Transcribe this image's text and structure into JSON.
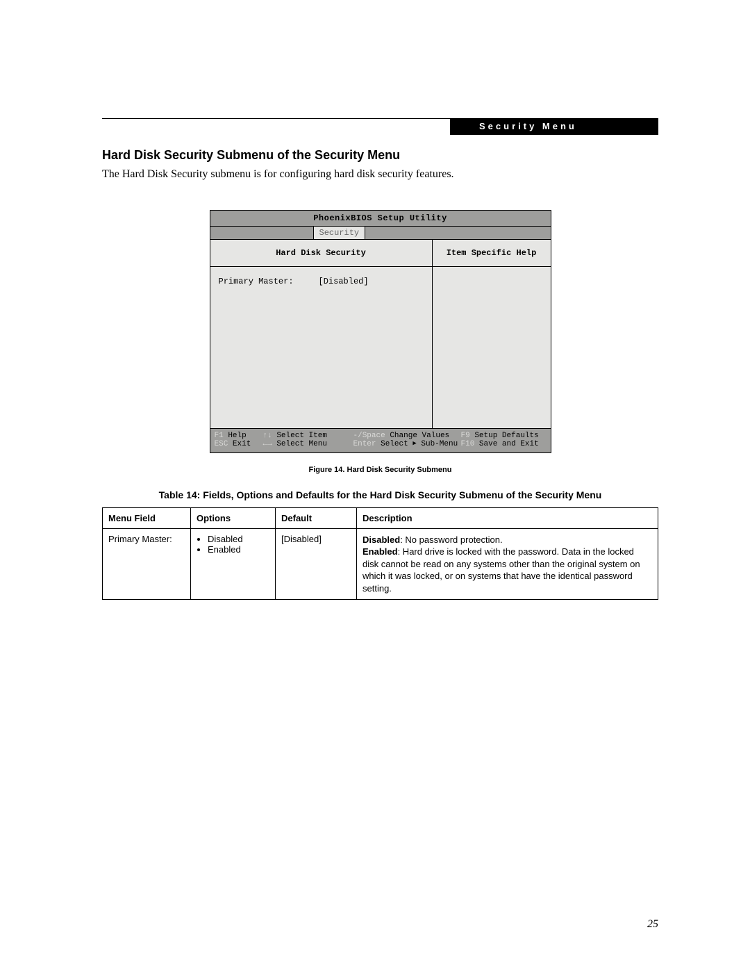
{
  "header": {
    "section_tab": "Security Menu"
  },
  "heading": "Hard Disk Security Submenu of the Security Menu",
  "intro": "The Hard Disk Security submenu is for configuring hard disk security features.",
  "bios": {
    "title": "PhoenixBIOS Setup Utility",
    "active_tab": "Security",
    "left_heading": "Hard Disk Security",
    "right_heading": "Item Specific Help",
    "field_label": "Primary Master:",
    "field_value": "[Disabled]",
    "footer": {
      "r1": {
        "k1": "F1",
        "a1": "Help",
        "k2": "↑↓",
        "a2": "Select Item",
        "k3": "-/Space",
        "a3": "Change Values",
        "k4": "F9",
        "a4": "Setup Defaults"
      },
      "r2": {
        "k1": "ESC",
        "a1": "Exit",
        "k2": "←→",
        "a2": "Select Menu",
        "k3": "Enter",
        "a3_pre": "Select ",
        "a3_post": " Sub-Menu",
        "k4": "F10",
        "a4": "Save and Exit"
      }
    }
  },
  "figure_caption": "Figure 14.   Hard Disk Security Submenu",
  "table_caption": "Table 14: Fields, Options and Defaults for the Hard Disk Security Submenu of the Security Menu",
  "table": {
    "headers": {
      "menu_field": "Menu Field",
      "options": "Options",
      "default": "Default",
      "description": "Description"
    },
    "row": {
      "menu_field": "Primary Master:",
      "options": [
        "Disabled",
        "Enabled"
      ],
      "default": "[Disabled]",
      "description": {
        "disabled_label": "Disabled",
        "disabled_text": ": No password protection.",
        "enabled_label": "Enabled",
        "enabled_text": ": Hard drive is locked with the password. Data in the locked disk cannot be read on any systems other than the original system on which it was locked, or on systems that have the identical password setting."
      }
    }
  },
  "page_number": "25"
}
